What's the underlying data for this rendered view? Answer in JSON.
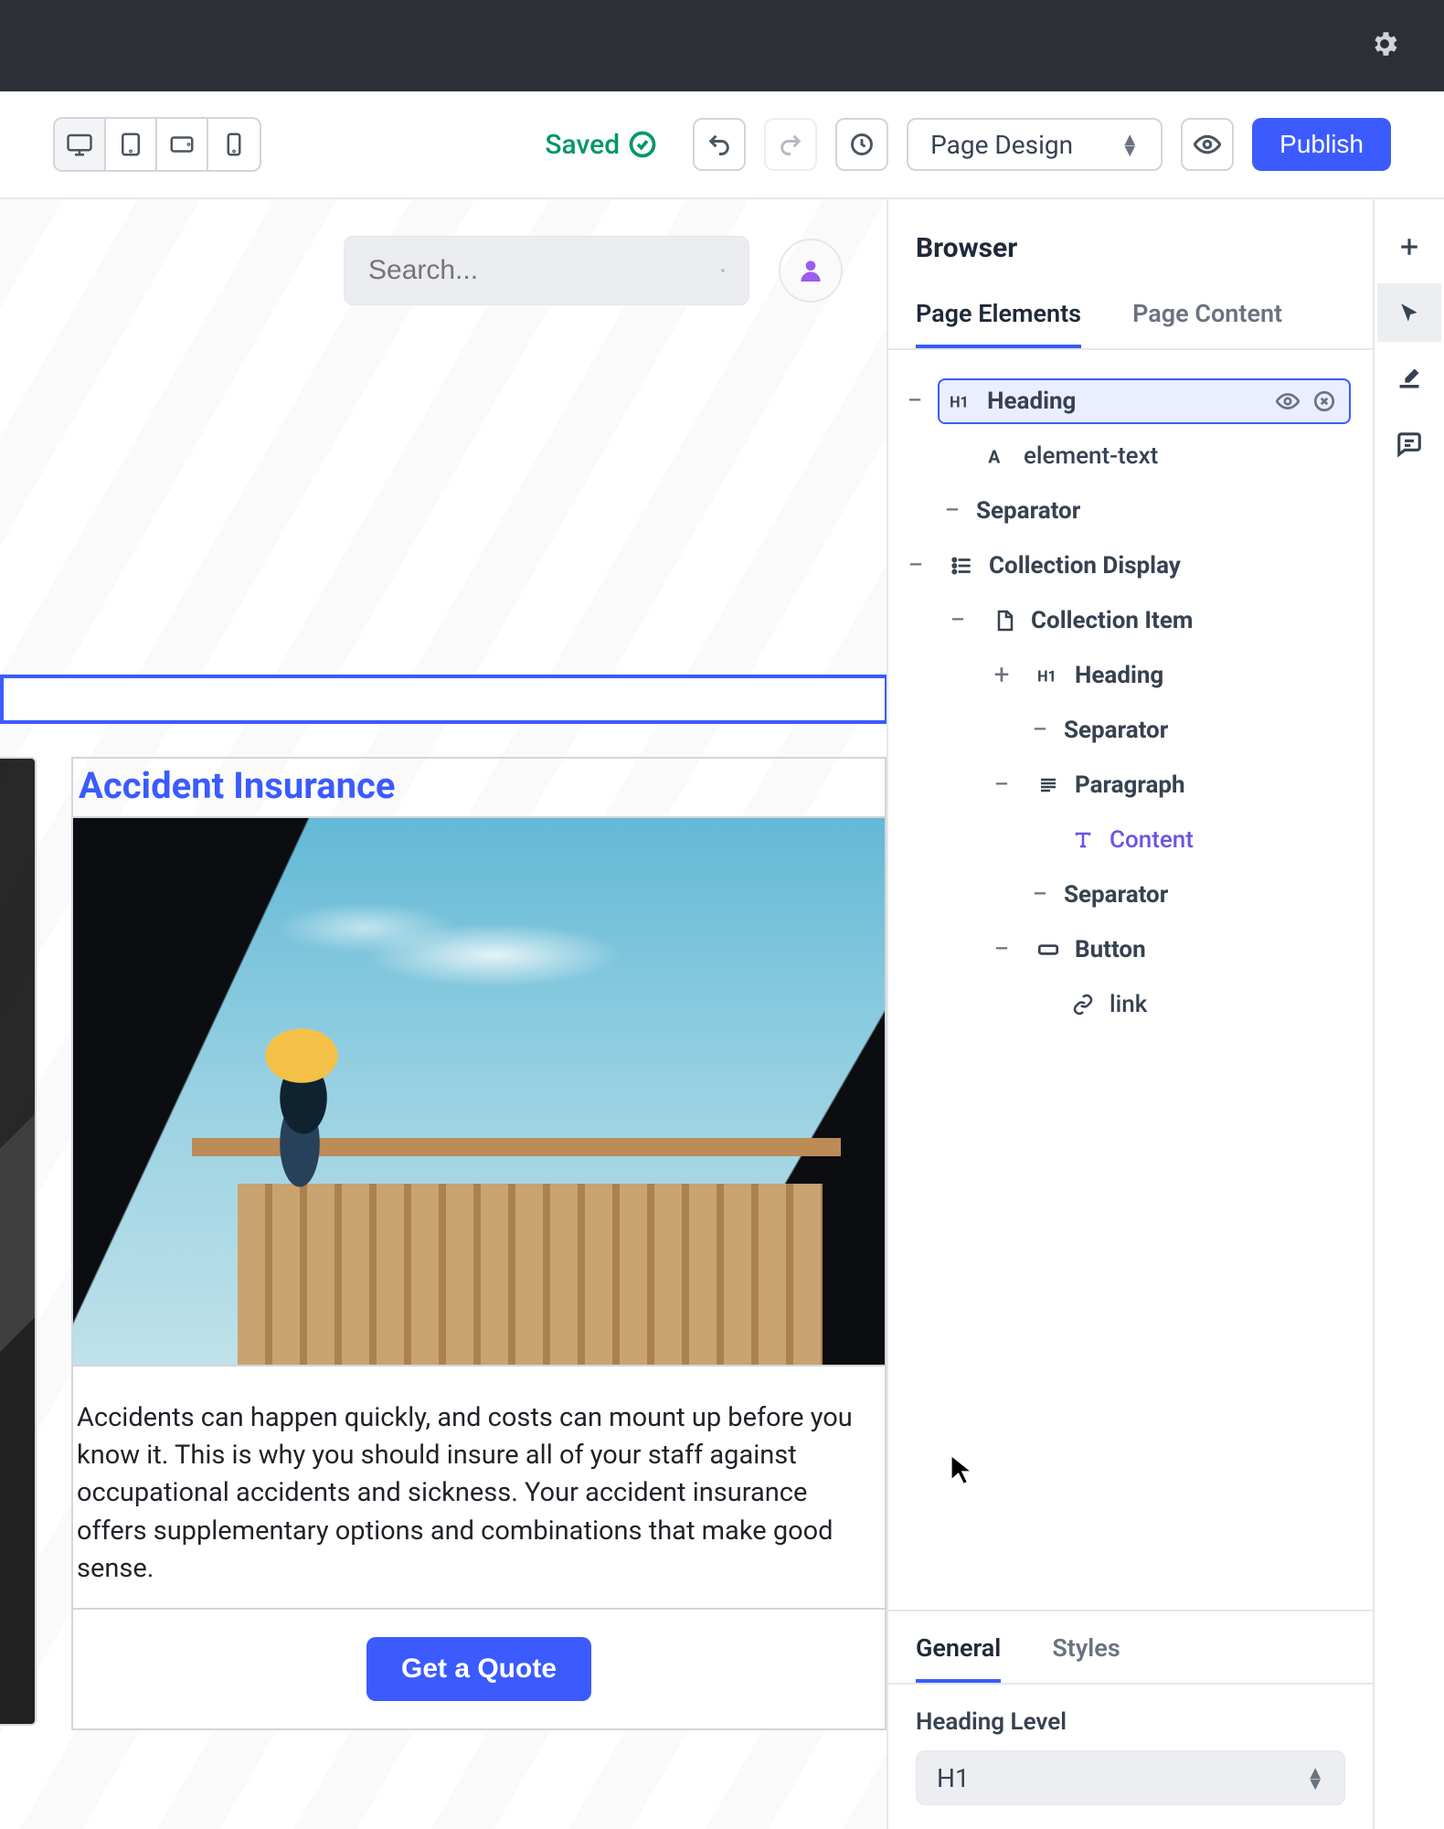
{
  "toolbar": {
    "saved_label": "Saved",
    "mode_label": "Page Design",
    "publish_label": "Publish"
  },
  "preview": {
    "search_placeholder": "Search...",
    "card": {
      "title": "Accident Insurance",
      "paragraph": "Accidents can happen quickly, and costs can mount up before you know it. This is why you should insure all of your staff against occupational accidents and sickness. Your accident insurance offers supplementary options and combinations that make good sense.",
      "button_label": "Get a Quote"
    }
  },
  "inspector": {
    "title": "Browser",
    "tabs": {
      "elements": "Page Elements",
      "content": "Page Content"
    },
    "tree": {
      "heading": "Heading",
      "element_text": "element-text",
      "separator": "Separator",
      "collection_display": "Collection Display",
      "collection_item": "Collection Item",
      "heading2": "Heading",
      "separator2": "Separator",
      "paragraph": "Paragraph",
      "content": "Content",
      "separator3": "Separator",
      "button": "Button",
      "link": "link"
    },
    "props": {
      "tabs": {
        "general": "General",
        "styles": "Styles"
      },
      "heading_level_label": "Heading Level",
      "heading_level_value": "H1"
    }
  }
}
